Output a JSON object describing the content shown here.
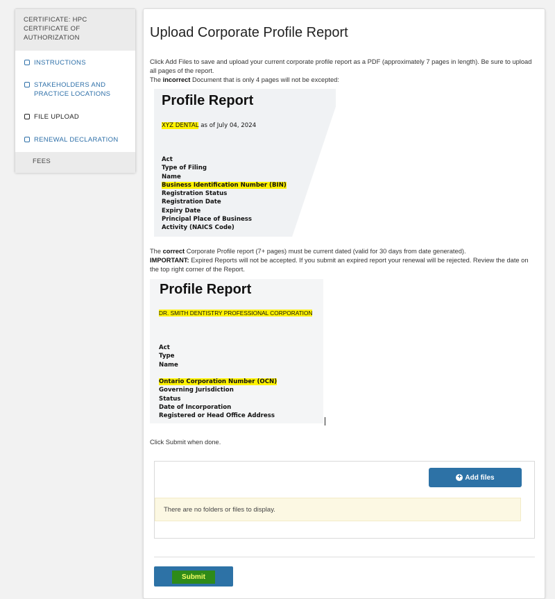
{
  "sidebar": {
    "header": "CERTIFICATE: HPC CERTIFICATE OF AUTHORIZATION",
    "items": [
      {
        "label": "INSTRUCTIONS"
      },
      {
        "label": "STAKEHOLDERS AND PRACTICE LOCATIONS"
      },
      {
        "label": "FILE UPLOAD"
      },
      {
        "label": "RENEWAL DECLARATION"
      }
    ],
    "fees": "FEES"
  },
  "main": {
    "title": "Upload Corporate Profile Report",
    "intro": "Click Add Files to save and upload your current corporate profile report as a PDF (approximately 7 pages in length). Be sure to upload all pages of the report.",
    "incorrect_prefix": "The ",
    "incorrect_bold": "incorrect",
    "incorrect_suffix": " Document that is only 4 pages will not be excepted:",
    "correct_prefix": "The ",
    "correct_bold": "correct",
    "correct_suffix": " Corporate Profile report (7+ pages) must be current dated (valid for 30 days from date generated).",
    "important_bold": "IMPORTANT:",
    "important_text": " Expired Reports will not be accepted. If you submit an expired report your renewal will be rejected. Review the date on the top right corner of the Report.",
    "click_submit": "Click Submit when done."
  },
  "report_incorrect": {
    "title": "Profile Report",
    "name": "XYZ DENTAL",
    "date": " as of July 04, 2024",
    "fields": [
      "Act",
      "Type of Filing",
      "Name",
      "Business Identification Number (BIN)",
      "Registration Status",
      "Registration Date",
      "Expiry Date",
      "Principal Place of Business",
      "Activity (NAICS Code)"
    ]
  },
  "report_correct": {
    "title": "Profile Report",
    "name": "DR. SMITH DENTISTRY PROFESSIONAL CORPORATION",
    "fields": [
      "Act",
      "Type",
      "Name",
      "",
      "Ontario Corporation Number (OCN)",
      "Governing Jurisdiction",
      "Status",
      "Date of Incorporation",
      "Registered or Head Office Address"
    ]
  },
  "files": {
    "add_label": "Add files",
    "empty": "There are no folders or files to display."
  },
  "submit_label": "Submit",
  "colors": {
    "primary": "#2d72a6",
    "highlight": "#fff200",
    "submit_highlight": "#2e8b19"
  }
}
